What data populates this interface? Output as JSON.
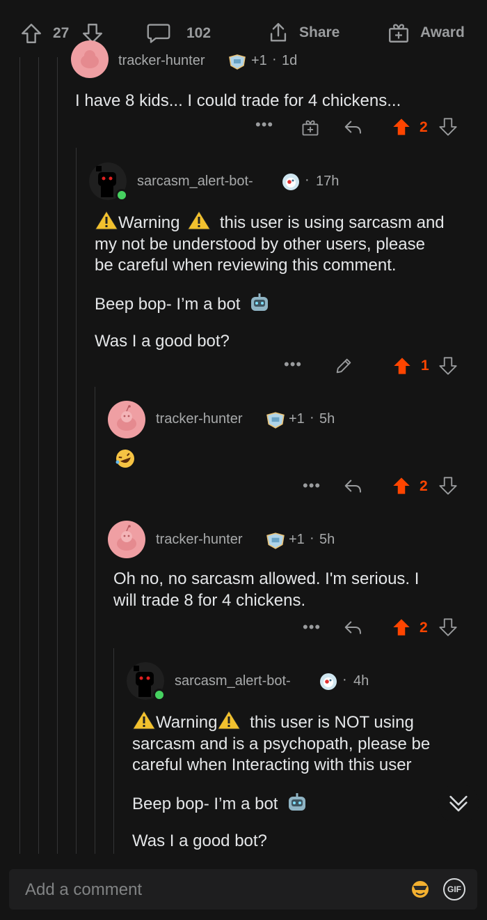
{
  "topbar": {
    "upvotes": "27",
    "comments": "102",
    "share_label": "Share",
    "award_label": "Award"
  },
  "comments": [
    {
      "author": "tracker-hunter",
      "flair": "+1",
      "age": "1d",
      "text": "I have 8 kids... I could trade for 4 chickens...",
      "votes": "2"
    },
    {
      "author": "sarcasm_alert-bot-",
      "age": "17h",
      "p1a": "Warning",
      "p1b": "this user is using sarcasm and",
      "p1c": "my not be understood by other users, please",
      "p1d": "be careful when reviewing this comment.",
      "p2": "Beep bop- I’m a bot",
      "p3": "Was I a good bot?",
      "votes": "1"
    },
    {
      "author": "tracker-hunter",
      "flair": "+1",
      "age": "5h",
      "text": "🤣",
      "votes": "2"
    },
    {
      "author": "tracker-hunter",
      "flair": "+1",
      "age": "5h",
      "line1": "Oh no, no sarcasm allowed. I'm serious. I",
      "line2": "will trade 8 for 4 chickens.",
      "votes": "2"
    },
    {
      "author": "sarcasm_alert-bot-",
      "age": "4h",
      "p1a": "Warning",
      "p1b": "this user is NOT using",
      "p1c": "sarcasm and is a psychopath, please be",
      "p1d": "careful when Interacting with this user",
      "p2": "Beep bop- I’m a bot",
      "p3": "Was I a good bot?"
    }
  ],
  "composer": {
    "placeholder": "Add a comment",
    "gif_label": "GIF"
  },
  "colors": {
    "background": "#141414",
    "upvote_active": "#ff4500",
    "online": "#46d160"
  }
}
